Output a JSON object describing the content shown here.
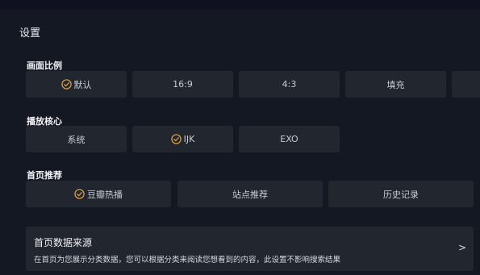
{
  "page": {
    "title": "设置"
  },
  "aspect": {
    "label": "画面比例",
    "options": [
      "默认",
      "16:9",
      "4:3",
      "填充"
    ],
    "selected": "默认"
  },
  "player": {
    "label": "播放核心",
    "options": [
      "系统",
      "IJK",
      "EXO"
    ],
    "selected": "IJK"
  },
  "home": {
    "label": "首页推荐",
    "options": [
      "豆瓣热播",
      "站点推荐",
      "历史记录"
    ],
    "selected": "豆瓣热播"
  },
  "source": {
    "title": "首页数据来源",
    "description": "在首页为您展示分类数据，您可以根据分类来阅读您想看到的内容，此设置不影响搜索结果",
    "chevron": ">"
  },
  "colors": {
    "accent": "#e6a23c",
    "background": "#141822",
    "option_bg": "#22262f"
  }
}
